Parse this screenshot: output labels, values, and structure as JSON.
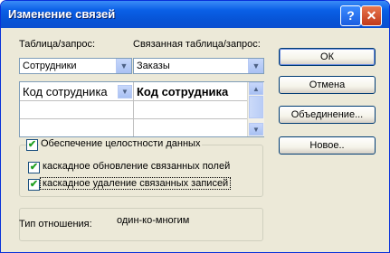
{
  "window": {
    "title": "Изменение связей",
    "help_glyph": "?",
    "close_glyph": "✕"
  },
  "labels": {
    "table_query": "Таблица/запрос:",
    "related_table_query": "Связанная таблица/запрос:"
  },
  "combos": {
    "table": "Сотрудники",
    "related_table": "Заказы",
    "arrow_glyph": "▼"
  },
  "grid": {
    "left_field": "Код сотрудника",
    "right_field": "Код сотрудника",
    "scroll_up_glyph": "▲",
    "scroll_down_glyph": "▼"
  },
  "options": {
    "integrity": "Обеспечение целостности данных",
    "cascade_update": "каскадное обновление связанных полей",
    "cascade_delete": "каскадное удаление связанных записей",
    "integrity_checked": true,
    "cascade_update_checked": true,
    "cascade_delete_checked": true,
    "check_glyph": "✔"
  },
  "relationship": {
    "label": "Тип отношения:",
    "value": "один-ко-многим"
  },
  "buttons": {
    "ok": "ОК",
    "cancel": "Отмена",
    "join": "Объединение...",
    "new": "Новое.."
  }
}
